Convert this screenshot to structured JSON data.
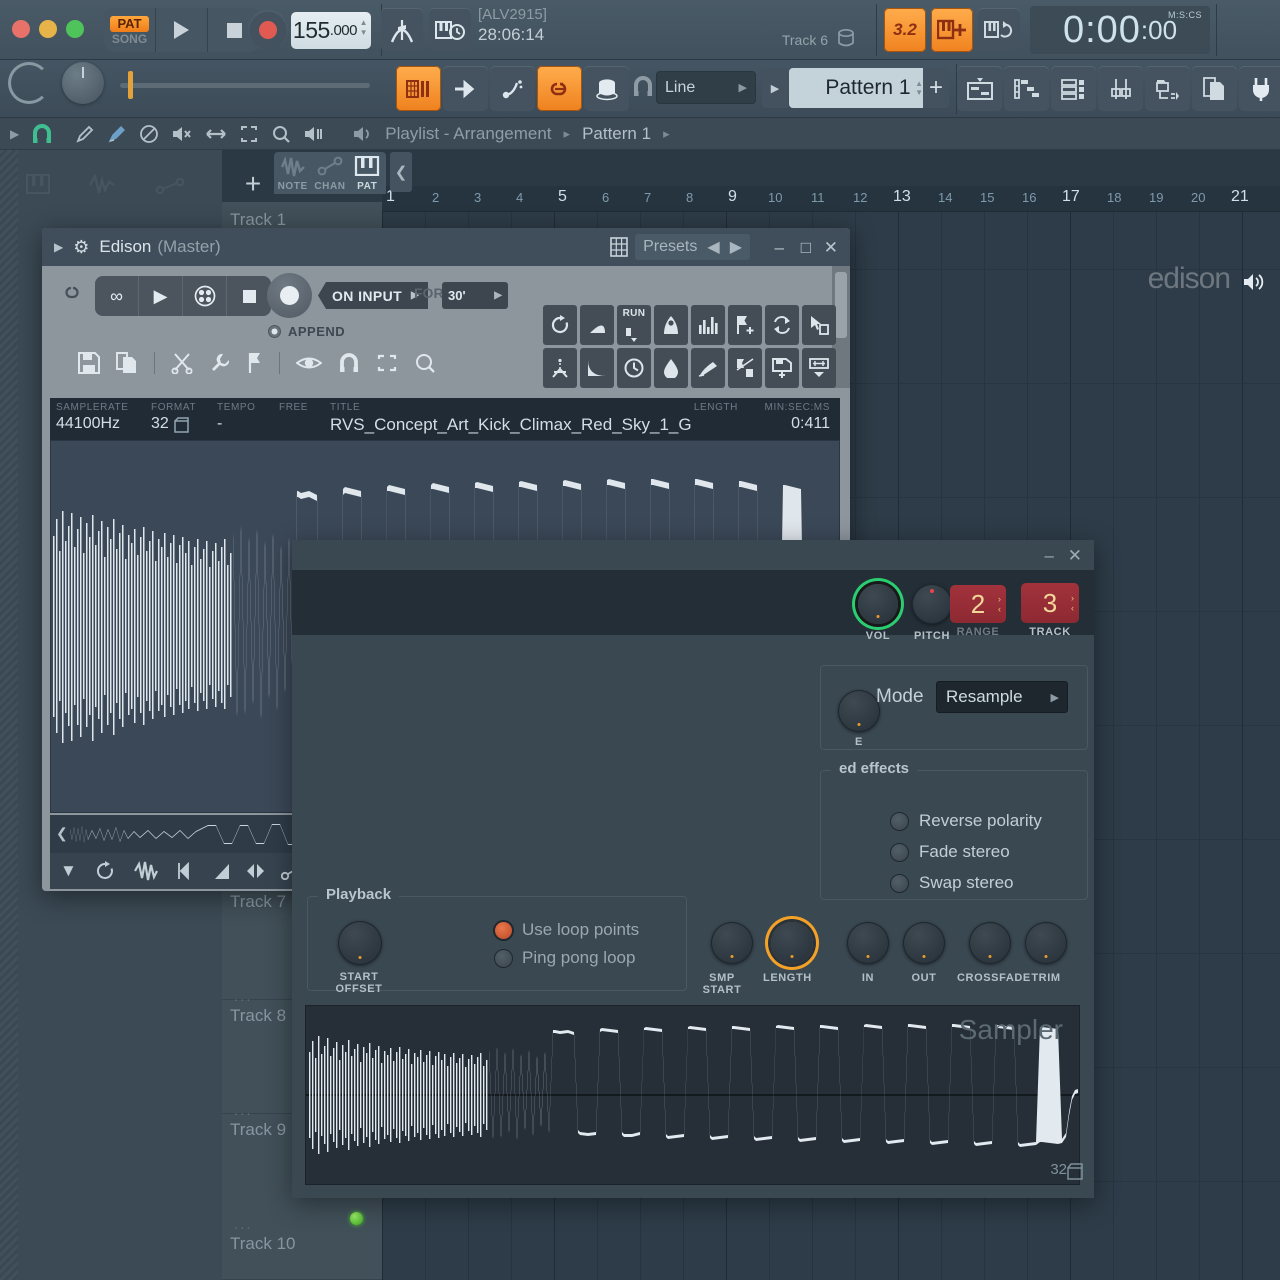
{
  "app": {
    "transport": {
      "pattern_label": "PAT",
      "song_label": "SONG",
      "tempo": "155",
      "tempo_fraction": ".000",
      "time_id": "[ALV2915]",
      "time_elapsed": "28:06:14",
      "track_hint": "Track 6",
      "orange_btn_1": "3.2",
      "orange_btn_2": "III+",
      "clock_main": "0:00",
      "clock_secondary": "00",
      "clock_unit": "M:S:CS"
    },
    "toolbar": {
      "snap_value": "Line",
      "pattern_value": "Pattern 1",
      "add_label": "+"
    },
    "breadcrumb": {
      "root": "Playlist - Arrangement",
      "sep": "▸",
      "current": "Pattern 1",
      "trail_sep": "▸"
    }
  },
  "playlist": {
    "tabs": [
      {
        "label": "NOTE",
        "selected": false
      },
      {
        "label": "CHAN",
        "selected": false
      },
      {
        "label": "PAT",
        "selected": true
      }
    ],
    "ruler": [
      {
        "n": "1",
        "major": true
      },
      {
        "n": "2",
        "major": false
      },
      {
        "n": "3",
        "major": false
      },
      {
        "n": "4",
        "major": false
      },
      {
        "n": "5",
        "major": true
      },
      {
        "n": "6",
        "major": false
      },
      {
        "n": "7",
        "major": false
      },
      {
        "n": "8",
        "major": false
      },
      {
        "n": "9",
        "major": true
      },
      {
        "n": "10",
        "major": false
      },
      {
        "n": "11",
        "major": false
      },
      {
        "n": "12",
        "major": false
      },
      {
        "n": "13",
        "major": true
      },
      {
        "n": "14",
        "major": false
      },
      {
        "n": "15",
        "major": false
      },
      {
        "n": "16",
        "major": false
      },
      {
        "n": "17",
        "major": true
      },
      {
        "n": "18",
        "major": false
      },
      {
        "n": "19",
        "major": false
      },
      {
        "n": "20",
        "major": false
      },
      {
        "n": "21",
        "major": true
      }
    ],
    "tracks": [
      {
        "label": "Track 1",
        "dots": "..."
      },
      {
        "label": "Track 7",
        "dots": "..."
      },
      {
        "label": "Track 8",
        "dots": "..."
      },
      {
        "label": "Track 9",
        "dots": "..."
      },
      {
        "label": "Track 10",
        "dots": "..."
      }
    ]
  },
  "edison": {
    "title": "Edison",
    "subtitle": "(Master)",
    "presets_label": "Presets",
    "record": {
      "on_input": "ON INPUT",
      "for_label": "FOR",
      "duration": "30'",
      "append": "APPEND"
    },
    "brand": "edison",
    "info": {
      "samplerate_label": "SAMPLERATE",
      "samplerate_value": "44100Hz",
      "format_label": "FORMAT",
      "format_value": "32",
      "tempo_label": "TEMPO",
      "tempo_value": "-",
      "free_label": "FREE",
      "title_label": "TITLE",
      "title_value": "RVS_Concept_Art_Kick_Climax_Red_Sky_1_G",
      "length_label": "LENGTH",
      "length_value": "0:411",
      "minsecms_label": "MIN:SEC:MS"
    },
    "tool_grid_run": "RUN"
  },
  "sampler": {
    "vol_label": "VOL",
    "pitch_label": "PITCH",
    "range_label": "RANGE",
    "range_value": "2",
    "track_label": "TRACK",
    "track_value": "3",
    "mode_label": "Mode",
    "mode_value": "Resample",
    "effects_group": "ed effects",
    "effects": [
      {
        "label": "Reverse polarity",
        "on": false
      },
      {
        "label": "Fade stereo",
        "on": false
      },
      {
        "label": "Swap stereo",
        "on": false
      }
    ],
    "playback_group": "Playback",
    "start_offset_label": "START OFFSET",
    "loop_options": [
      {
        "label": "Use loop points",
        "on": true
      },
      {
        "label": "Ping pong loop",
        "on": false
      }
    ],
    "knobs": [
      {
        "label": "SMP START",
        "active": false
      },
      {
        "label": "LENGTH",
        "active": true
      },
      {
        "label": "IN",
        "active": false
      },
      {
        "label": "OUT",
        "active": false
      },
      {
        "label": "CROSSFADE",
        "active": false
      },
      {
        "label": "TRIM",
        "active": false
      }
    ],
    "wave_label": "Sampler",
    "format_value": "32"
  },
  "colors": {
    "accent_orange": "#f0821f",
    "accent_green": "#2acd6f",
    "accent_red": "#a2323c",
    "panel_bg": "#3a4852",
    "window_bg": "#384853"
  }
}
